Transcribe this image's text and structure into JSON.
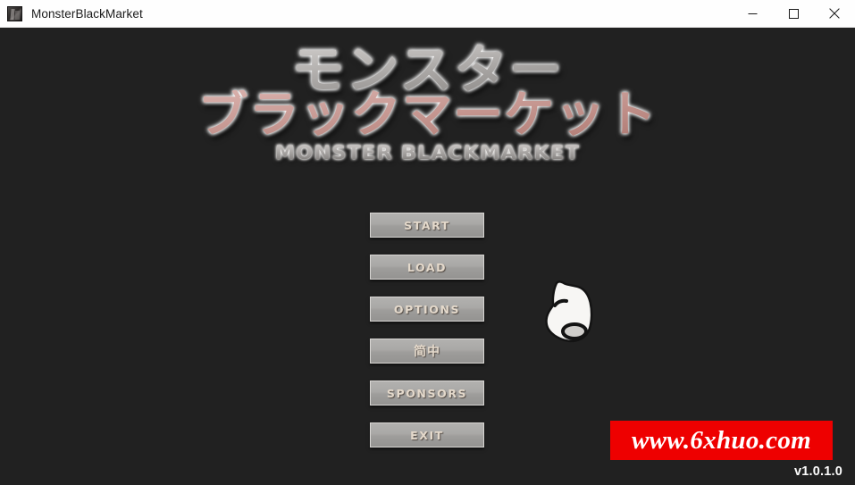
{
  "window": {
    "title": "MonsterBlackMarket",
    "icon": "app-icon",
    "controls": {
      "minimize": "minimize-icon",
      "maximize": "maximize-icon",
      "close": "close-icon"
    }
  },
  "colors": {
    "background": "#212121",
    "titlebar": "#fefefe",
    "button_face": "#a9a8a6",
    "button_border": "#d8d6d3",
    "button_label": "#e4d9cb",
    "logo_stone": "#c6c3c1",
    "logo_pink": "#cfa39e",
    "watermark_red": "#ee0000",
    "watermark_text": "#ffffff",
    "version_text": "#fdfdfd"
  },
  "logo": {
    "line1": "モンスター",
    "line2": "ブラックマーケット",
    "subtitle": "MONSTER BLACKMARKET"
  },
  "menu": {
    "buttons": [
      {
        "id": "start",
        "label": "START"
      },
      {
        "id": "load",
        "label": "LOAD"
      },
      {
        "id": "options",
        "label": "OPTIONS"
      },
      {
        "id": "language",
        "label": "简中"
      },
      {
        "id": "sponsors",
        "label": "SPONSORS"
      },
      {
        "id": "exit",
        "label": "EXIT"
      }
    ]
  },
  "cursor": {
    "icon": "pointing-hand-cursor"
  },
  "watermark": {
    "text": "www.6xhuo.com"
  },
  "footer": {
    "version": "v1.0.1.0"
  }
}
